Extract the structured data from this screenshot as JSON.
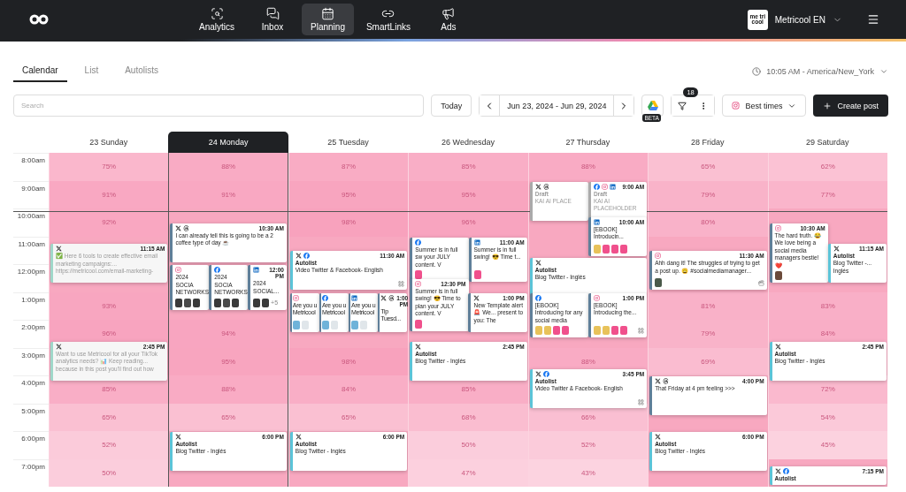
{
  "nav": {
    "items": [
      {
        "label": "Analytics",
        "selected": false
      },
      {
        "label": "Inbox",
        "selected": false
      },
      {
        "label": "Planning",
        "selected": true
      },
      {
        "label": "SmartLinks",
        "selected": false
      },
      {
        "label": "Ads",
        "selected": false
      }
    ],
    "account": {
      "avatar": "me tri cool",
      "name": "Metricool EN"
    }
  },
  "tabs": [
    {
      "label": "Calendar",
      "selected": true
    },
    {
      "label": "List",
      "selected": false
    },
    {
      "label": "Autolists",
      "selected": false
    }
  ],
  "timezone": "10:05 AM - America/New_York",
  "toolbar": {
    "search_placeholder": "Search",
    "today": "Today",
    "range": "Jun 23, 2024 - Jun 29, 2024",
    "drive_badge": "BETA",
    "filter_count": "18",
    "best_times": "Best times",
    "create": "Create post"
  },
  "hours": [
    "8:00am",
    "9:00am",
    "10:00am",
    "11:00am",
    "12:00pm",
    "1:00pm",
    "2:00pm",
    "3:00pm",
    "4:00pm",
    "5:00pm",
    "6:00pm",
    "7:00pm"
  ],
  "days": [
    {
      "label": "23 Sunday",
      "selected": false,
      "cells": [
        "75%",
        "91%",
        "92%",
        null,
        null,
        "93%",
        "96%",
        null,
        "85%",
        "65%",
        "52%",
        "50%"
      ],
      "slots": [
        {
          "at": "11:15 AM",
          "time_shown": true,
          "cards": [
            {
              "kind": "published",
              "networks": [
                {
                  "kind": "x"
                }
              ],
              "faded": true,
              "text": "✅ Here 6 tools to create effective email marketing campaigns:... https://metricool.com/email-marketing-"
            }
          ]
        },
        {
          "at": "2:45 PM",
          "time_shown": true,
          "cards": [
            {
              "kind": "published",
              "networks": [
                {
                  "kind": "x"
                }
              ],
              "faded": true,
              "text": "Want to use Metricool for all your TikTok analytics needs? 📊 Keep reading... because in this post you'll find out how"
            }
          ]
        }
      ]
    },
    {
      "label": "24 Monday",
      "selected": true,
      "cells": [
        "88%",
        "91%",
        null,
        null,
        null,
        null,
        "94%",
        "95%",
        "88%",
        "65%",
        null,
        null
      ],
      "slots": [
        {
          "at": "10:30 AM",
          "time_shown": true,
          "cards": [
            {
              "kind": "scheduled",
              "networks": [
                {
                  "kind": "x"
                },
                {
                  "kind": "threads"
                }
              ],
              "faded": false,
              "text": "I can already tell this is going to be a 2 coffee type of day ☕"
            }
          ]
        },
        {
          "at": "12:00 PM",
          "time_shown": true,
          "cards": [
            {
              "kind": "scheduled",
              "networks": [
                {
                  "kind": "instagram"
                }
              ],
              "faded": false,
              "text": "2024 SOCIA NETWORKS",
              "thumbs": [
                {
                  "color": "#3a3a3a"
                },
                {
                  "color": "#4a4a4a"
                },
                {
                  "color": "#3a3a3a"
                }
              ]
            },
            {
              "kind": "scheduled",
              "networks": [
                {
                  "kind": "facebook"
                }
              ],
              "faded": false,
              "text": "2024 SOCIA NETWORKS",
              "thumbs": [
                {
                  "color": "#3a3a3a"
                },
                {
                  "color": "#4a4a4a"
                },
                {
                  "color": "#3a3a3a"
                }
              ]
            },
            {
              "kind": "scheduled",
              "networks": [
                {
                  "kind": "linkedin"
                }
              ],
              "faded": false,
              "text": "2024 SOCIAL...",
              "thumbs": [
                {
                  "color": "#3a3a3a"
                },
                {
                  "color": "#3a3a3a"
                }
              ],
              "more": "+5"
            }
          ]
        },
        {
          "at": "6:00 PM",
          "time_shown": true,
          "cards": [
            {
              "kind": "autolist",
              "networks": [
                {
                  "kind": "x"
                }
              ],
              "label": "Autolist",
              "faded": false,
              "text": "Blog Twitter - Inglés"
            }
          ]
        }
      ]
    },
    {
      "label": "25 Tuesday",
      "selected": false,
      "cells": [
        "87%",
        "95%",
        "98%",
        null,
        null,
        null,
        null,
        "98%",
        "84%",
        "65%",
        null,
        null
      ],
      "slots": [
        {
          "at": "11:30 AM",
          "time_shown": true,
          "cards": [
            {
              "kind": "autolist",
              "networks": [
                {
                  "kind": "x"
                },
                {
                  "kind": "facebook"
                }
              ],
              "label": "Autolist",
              "faded": false,
              "text": "Video Twitter & Facebook- English",
              "tool": {
                "kind": "grid"
              }
            }
          ]
        },
        {
          "at": "1:00 PM",
          "time_shown": true,
          "cards": [
            {
              "kind": "scheduled",
              "networks": [
                {
                  "kind": "instagram"
                }
              ],
              "faded": false,
              "text": "Are you u Metricool",
              "thumbs": [
                {
                  "color": "#6fb3d9"
                },
                {
                  "color": "#e0e6ea"
                }
              ]
            },
            {
              "kind": "scheduled",
              "networks": [
                {
                  "kind": "facebook"
                }
              ],
              "faded": false,
              "text": "Are you u Metricool",
              "thumbs": [
                {
                  "color": "#6fb3d9"
                },
                {
                  "color": "#e0e6ea"
                }
              ]
            },
            {
              "kind": "scheduled",
              "networks": [
                {
                  "kind": "linkedin"
                }
              ],
              "faded": false,
              "text": "Are you u Metricool",
              "thumbs": [
                {
                  "color": "#6fb3d9"
                },
                {
                  "color": "#e0e6ea"
                }
              ]
            },
            {
              "kind": "scheduled",
              "networks": [
                {
                  "kind": "x"
                },
                {
                  "kind": "threads"
                }
              ],
              "faded": false,
              "text": "Tip Tuesd..."
            }
          ]
        },
        {
          "at": "6:00 PM",
          "time_shown": true,
          "cards": [
            {
              "kind": "autolist",
              "networks": [
                {
                  "kind": "x"
                }
              ],
              "label": "Autolist",
              "faded": false,
              "text": "Blog Twitter - Inglés"
            }
          ]
        }
      ]
    },
    {
      "label": "26 Wednesday",
      "selected": false,
      "cells": [
        "85%",
        "95%",
        "96%",
        null,
        null,
        null,
        null,
        null,
        "85%",
        "68%",
        "50%",
        "47%"
      ],
      "slots": [
        {
          "at": "11:00 AM",
          "time_shown": true,
          "cards": [
            {
              "kind": "scheduled",
              "networks": [
                {
                  "kind": "facebook"
                }
              ],
              "faded": false,
              "text": "Summer is in full sw your JULY content. V",
              "thumbs": [
                {
                  "color": "#f0508c"
                }
              ]
            },
            {
              "kind": "scheduled",
              "networks": [
                {
                  "kind": "linkedin"
                }
              ],
              "faded": false,
              "text": "Summer is in full swing! 😎 Time t...",
              "thumbs": [
                {
                  "color": "#f0508c"
                }
              ]
            }
          ]
        },
        {
          "at": "12:30 PM",
          "time_shown": true,
          "cards": [
            {
              "kind": "scheduled",
              "networks": [
                {
                  "kind": "instagram"
                }
              ],
              "faded": false,
              "text": "Summer is in full swing! 😎 Time to plan your JULY content. V",
              "thumbs": [
                {
                  "color": "#f0508c"
                }
              ]
            }
          ]
        },
        {
          "at": "1:00 PM",
          "time_shown": true,
          "cards": [
            {
              "kind": "scheduled",
              "networks": [
                {
                  "kind": "x"
                }
              ],
              "faded": false,
              "text": "New Template alert🚨 We... present to you: The"
            }
          ]
        },
        {
          "at": "2:45 PM",
          "time_shown": true,
          "cards": [
            {
              "kind": "autolist",
              "networks": [
                {
                  "kind": "x"
                }
              ],
              "label": "Autolist",
              "faded": false,
              "text": "Blog Twitter - Inglés"
            }
          ]
        }
      ]
    },
    {
      "label": "27 Thursday",
      "selected": false,
      "cells": [
        "88%",
        null,
        null,
        null,
        null,
        null,
        null,
        "88%",
        null,
        "66%",
        "52%",
        "43%"
      ],
      "slots": [
        {
          "at": "9:00 AM",
          "time_shown": true,
          "cards": [
            {
              "kind": "draft",
              "networks": [
                {
                  "kind": "x"
                },
                {
                  "kind": "threads"
                }
              ],
              "label": "Draft",
              "faded": false,
              "text": "KAI AI PLACE"
            },
            {
              "kind": "draft",
              "networks": [
                {
                  "kind": "facebook"
                },
                {
                  "kind": "instagram"
                },
                {
                  "kind": "linkedin"
                }
              ],
              "label": "Draft",
              "text": "KAI AI PLACEHOLDER"
            }
          ]
        },
        {
          "at": "10:00 AM",
          "time_shown": true,
          "cards": [
            {
              "kind": "scheduled",
              "networks": [
                {
                  "kind": "linkedin"
                }
              ],
              "faded": false,
              "text": "[EBOOK] Introducin...",
              "thumbs": [
                {
                  "color": "#e8c25a"
                },
                {
                  "color": "#f0508c"
                },
                {
                  "color": "#f0508c"
                },
                {
                  "color": "#f0508c"
                }
              ]
            }
          ]
        },
        {
          "cards": [
            {
              "kind": "autolist",
              "networks": [
                {
                  "kind": "x"
                }
              ],
              "label": "Autolist",
              "faded": false,
              "text": "Blog Twitter - Inglés"
            }
          ]
        },
        {
          "at": "1:00 PM",
          "time_shown": true,
          "cards": [
            {
              "kind": "scheduled",
              "networks": [
                {
                  "kind": "facebook"
                }
              ],
              "faded": false,
              "text": "[EBOOK] Introducing for any social media",
              "thumbs": [
                {
                  "color": "#e8c25a"
                },
                {
                  "color": "#e8c25a"
                },
                {
                  "color": "#f0508c"
                },
                {
                  "color": "#f0508c"
                }
              ]
            },
            {
              "kind": "scheduled",
              "networks": [
                {
                  "kind": "instagram"
                }
              ],
              "faded": false,
              "text": "[EBOOK] Introducing the...",
              "thumbs": [
                {
                  "color": "#e8c25a"
                },
                {
                  "color": "#e8c25a"
                },
                {
                  "color": "#f0508c"
                },
                {
                  "color": "#f0508c"
                }
              ],
              "tool": {
                "kind": "grid"
              }
            }
          ]
        },
        {
          "at": "3:45 PM",
          "time_shown": true,
          "cards": [
            {
              "kind": "autolist",
              "networks": [
                {
                  "kind": "x"
                },
                {
                  "kind": "facebook"
                }
              ],
              "label": "Autolist",
              "faded": false,
              "text": "Video Twitter & Facebook- English",
              "tool": {
                "kind": "grid"
              }
            }
          ]
        }
      ]
    },
    {
      "label": "28 Friday",
      "selected": false,
      "cells": [
        "65%",
        "79%",
        "80%",
        null,
        null,
        "81%",
        "79%",
        "69%",
        null,
        null,
        null,
        null
      ],
      "slots": [
        {
          "at": "11:30 AM",
          "time_shown": true,
          "cards": [
            {
              "kind": "scheduled",
              "networks": [
                {
                  "kind": "instagram"
                }
              ],
              "faded": false,
              "text": "Ahh dang it! The struggles of trying to get a post up. 😩 #socialmediamanager...",
              "thumbs": [
                {
                  "color": "#4a5a4a"
                }
              ],
              "tool": {
                "kind": "reel"
              }
            }
          ]
        },
        {
          "at": "4:00 PM",
          "time_shown": true,
          "cards": [
            {
              "kind": "scheduled",
              "networks": [
                {
                  "kind": "x"
                },
                {
                  "kind": "threads"
                }
              ],
              "faded": false,
              "text": "That Friday at 4 pm feeling >>>"
            }
          ]
        },
        {
          "at": "6:00 PM",
          "time_shown": true,
          "cards": [
            {
              "kind": "autolist",
              "networks": [
                {
                  "kind": "x"
                }
              ],
              "label": "Autolist",
              "faded": false,
              "text": "Blog Twitter - Inglés"
            }
          ]
        }
      ]
    },
    {
      "label": "29 Saturday",
      "selected": false,
      "cells": [
        "62%",
        "77%",
        null,
        null,
        null,
        "83%",
        "84%",
        null,
        "72%",
        "54%",
        "45%",
        null
      ],
      "slots": [
        {
          "at": "10:30 AM",
          "time_shown": true,
          "cards": [
            {
              "kind": "scheduled",
              "networks": [
                {
                  "kind": "instagram"
                }
              ],
              "faded": false,
              "text": "The hard truth. 😂 We love being a social media managers bestie! ❤️",
              "thumbs": [
                {
                  "color": "#6b4a3a"
                }
              ]
            }
          ]
        },
        {
          "at": "11:15 AM",
          "time_shown": true,
          "cards": [
            {
              "kind": "autolist",
              "networks": [
                {
                  "kind": "x"
                }
              ],
              "label": "Autolist",
              "faded": false,
              "text": "Blog Twitter -... Inglés"
            }
          ]
        },
        {
          "at": "2:45 PM",
          "time_shown": true,
          "cards": [
            {
              "kind": "autolist",
              "networks": [
                {
                  "kind": "x"
                }
              ],
              "label": "Autolist",
              "faded": false,
              "text": "Blog Twitter - Inglés"
            }
          ]
        },
        {
          "at": "7:15 PM",
          "time_shown": true,
          "cards": [
            {
              "kind": "autolist",
              "networks": [
                {
                  "kind": "x"
                },
                {
                  "kind": "facebook"
                }
              ],
              "label": "Autolist"
            }
          ]
        }
      ]
    }
  ]
}
